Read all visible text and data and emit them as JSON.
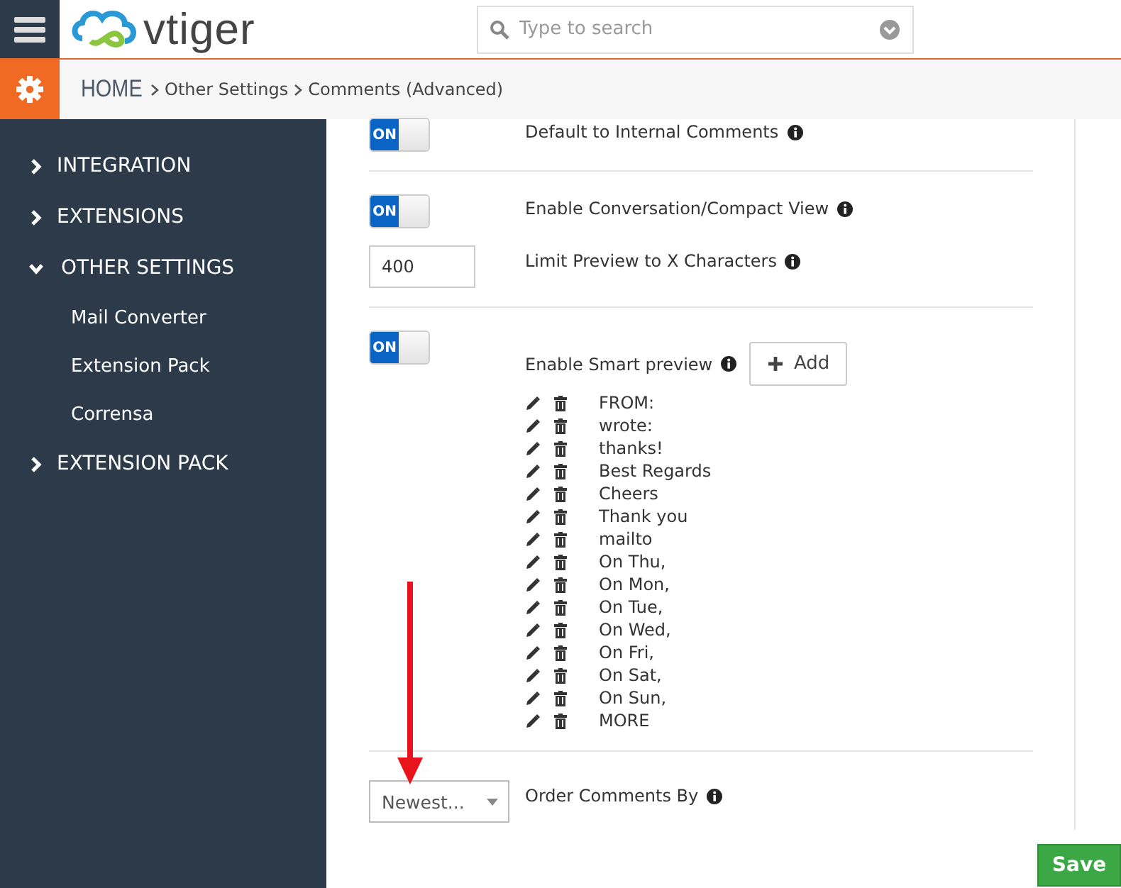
{
  "header": {
    "logo": "vtiger",
    "search": {
      "placeholder": "Type to search"
    }
  },
  "breadcrumb": [
    "HOME",
    "Other Settings",
    "Comments (Advanced)"
  ],
  "sidebar": {
    "items": [
      {
        "label": "INTEGRATION",
        "expanded": false
      },
      {
        "label": "EXTENSIONS",
        "expanded": false
      },
      {
        "label": "OTHER SETTINGS",
        "expanded": true,
        "children": [
          {
            "label": "Mail Converter"
          },
          {
            "label": "Extension Pack"
          },
          {
            "label": "Corrensa"
          }
        ]
      },
      {
        "label": "EXTENSION PACK",
        "expanded": false
      }
    ]
  },
  "sections": [
    {
      "settings": [
        {
          "kind": "toggle",
          "on": true,
          "toggle_label": "ON",
          "label": "Default to Internal Comments"
        }
      ]
    },
    {
      "settings": [
        {
          "kind": "toggle",
          "on": true,
          "toggle_label": "ON",
          "label": "Enable Conversation/Compact View"
        },
        {
          "kind": "number",
          "value": "400",
          "label": "Limit Preview to X Characters"
        }
      ]
    },
    {
      "settings": [
        {
          "kind": "toggle",
          "on": true,
          "toggle_label": "ON",
          "label": "Enable Smart preview",
          "add_button": "Add",
          "phrases": [
            "FROM:",
            "wrote:",
            "thanks!",
            "Best Regards",
            "Cheers",
            "Thank you",
            "mailto",
            "On Thu,",
            "On Mon,",
            "On Tue,",
            "On Wed,",
            "On Fri,",
            "On Sat,",
            "On Sun,",
            "MORE"
          ]
        }
      ]
    },
    {
      "settings": [
        {
          "kind": "select",
          "value": "Newest...",
          "label": "Order Comments By"
        }
      ]
    }
  ],
  "save_button": "Save"
}
